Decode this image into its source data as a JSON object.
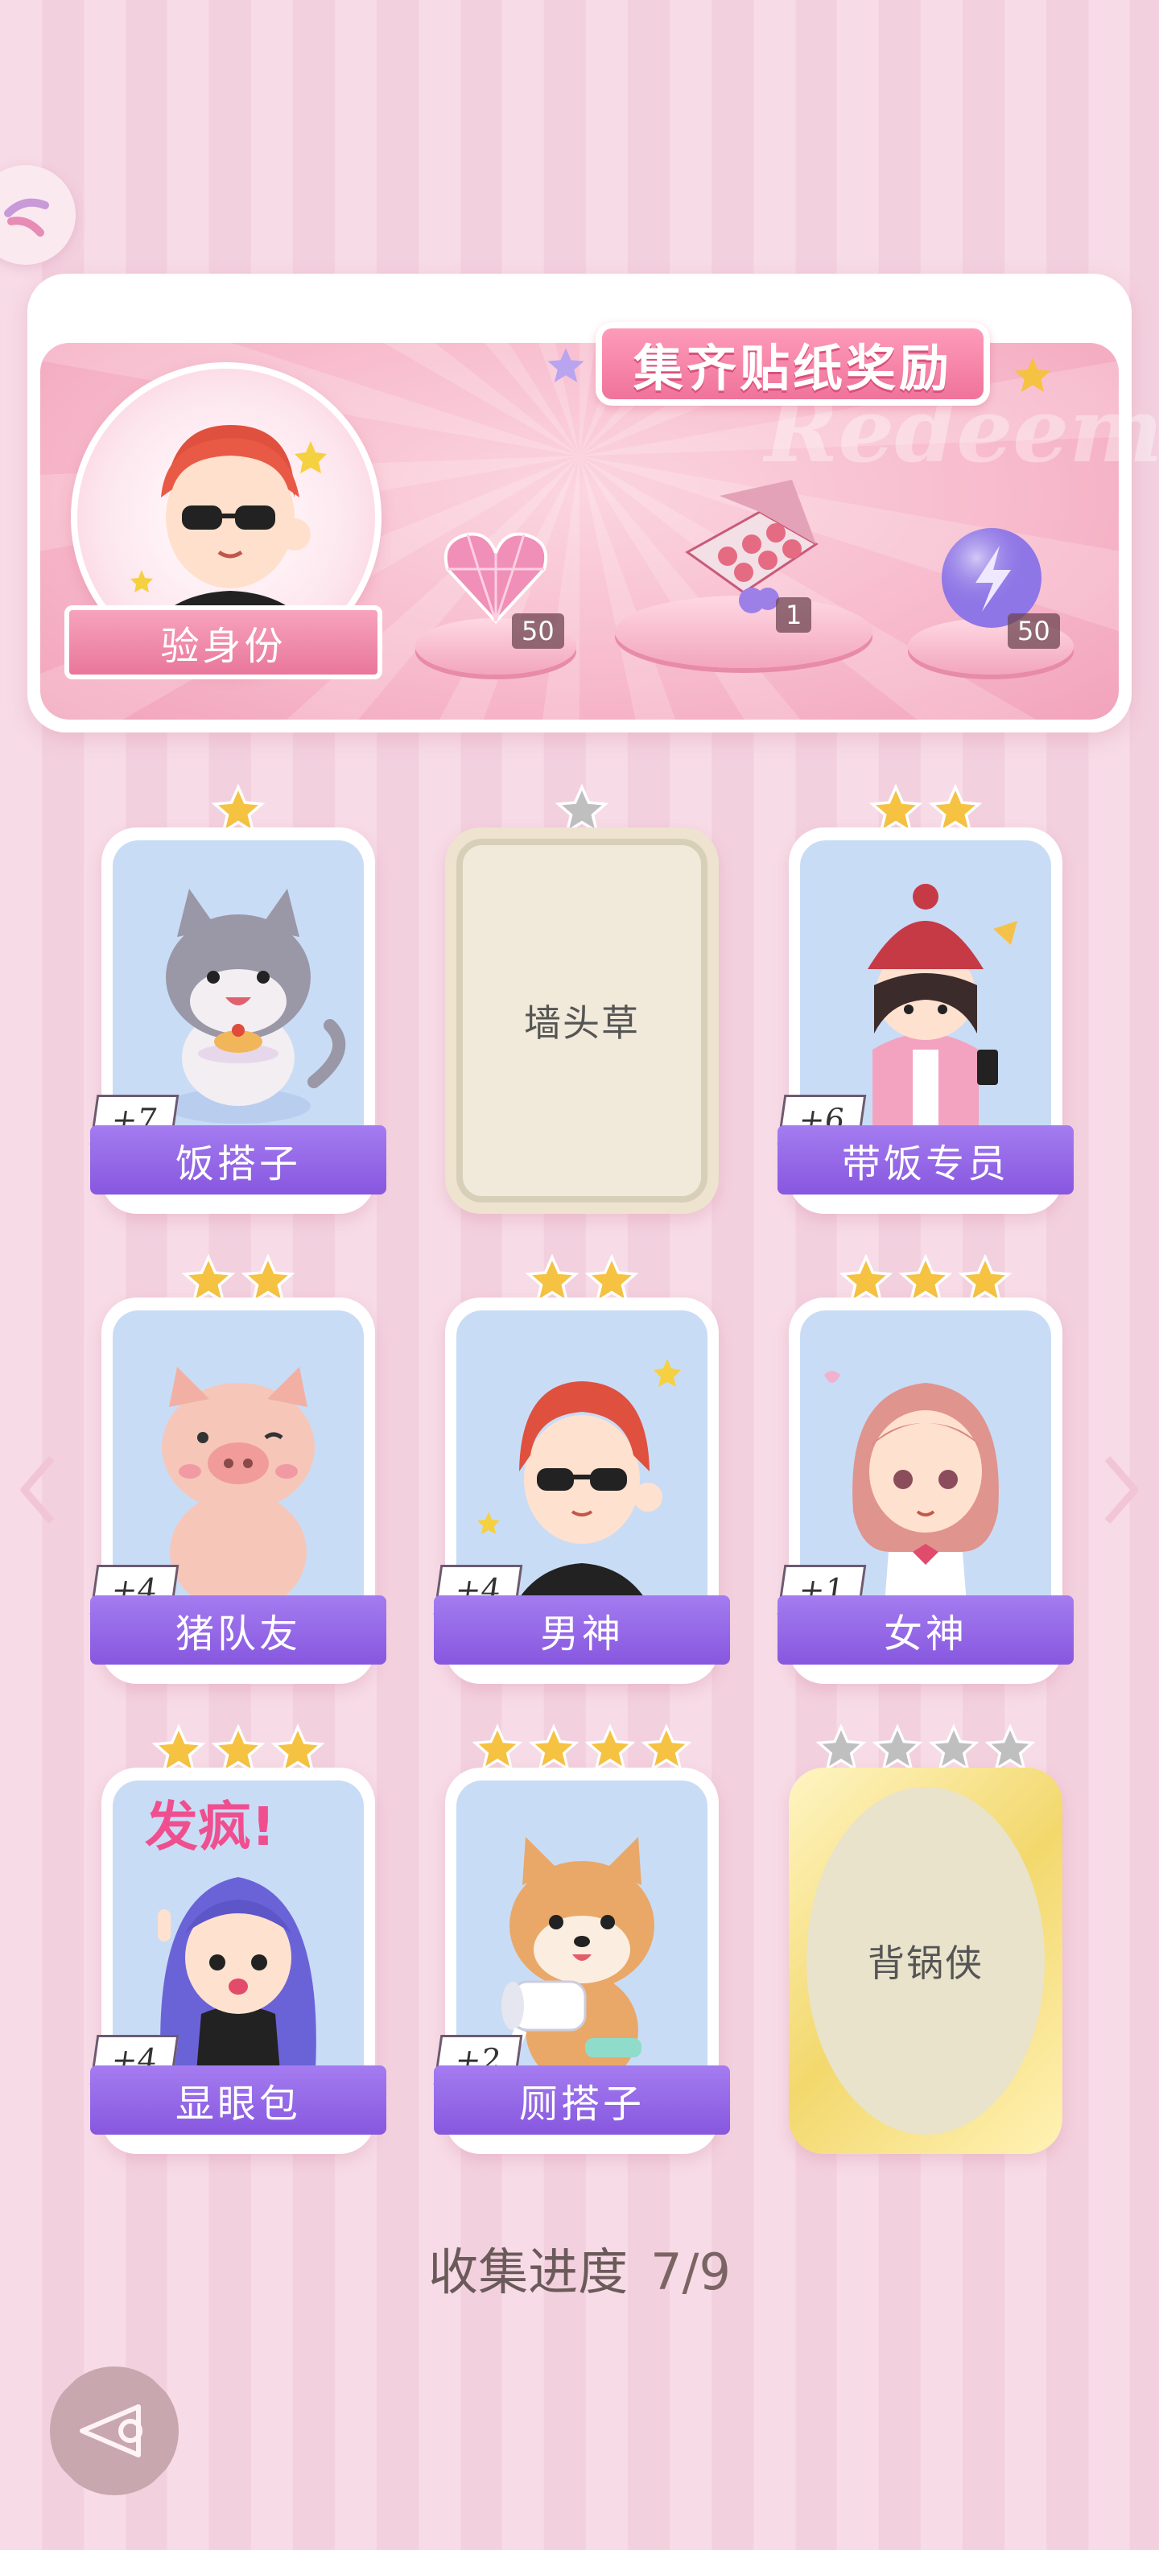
{
  "banner": {
    "title": "集齐贴纸奖励",
    "watermark": "Redeem",
    "verify_label": "验身份",
    "rewards": [
      {
        "icon": "pink-heart-gem-icon",
        "count": "50"
      },
      {
        "icon": "gift-box-icon",
        "count": "1"
      },
      {
        "icon": "purple-energy-orb-icon",
        "count": "50"
      }
    ]
  },
  "cards": [
    {
      "name": "饭搭子",
      "count": "+7",
      "stars": 1,
      "state": "owned",
      "art": "cat-with-pancake"
    },
    {
      "name": "墙头草",
      "count": "",
      "stars": 1,
      "state": "locked",
      "art": ""
    },
    {
      "name": "带饭专员",
      "count": "+6",
      "stars": 2,
      "state": "owned",
      "art": "girl-in-beanie"
    },
    {
      "name": "猪队友",
      "count": "+4",
      "stars": 2,
      "state": "owned",
      "art": "pig"
    },
    {
      "name": "男神",
      "count": "+4",
      "stars": 2,
      "state": "owned",
      "art": "red-hair-boy"
    },
    {
      "name": "女神",
      "count": "+1",
      "stars": 3,
      "state": "owned",
      "art": "pink-hair-girl"
    },
    {
      "name": "显眼包",
      "count": "+4",
      "stars": 3,
      "state": "owned",
      "art": "purple-hair-girl",
      "sticker_text": "发疯!"
    },
    {
      "name": "厕搭子",
      "count": "+2",
      "stars": 4,
      "state": "owned",
      "art": "shiba-with-toilet-paper"
    },
    {
      "name": "背锅侠",
      "count": "",
      "stars": 4,
      "state": "locked-gold",
      "art": ""
    }
  ],
  "progress": {
    "label": "收集进度",
    "value": "7/9"
  },
  "colors": {
    "name_bar": "#8757df",
    "star_gold": "#f5c242",
    "star_grey": "#bfbfbf",
    "banner_pink": "#f7b9cb"
  },
  "icons": {
    "top_left": "pinwheel-icon",
    "left_arrow": "chevron-left-icon",
    "right_arrow": "chevron-right-icon",
    "back": "back-triangle-icon"
  }
}
